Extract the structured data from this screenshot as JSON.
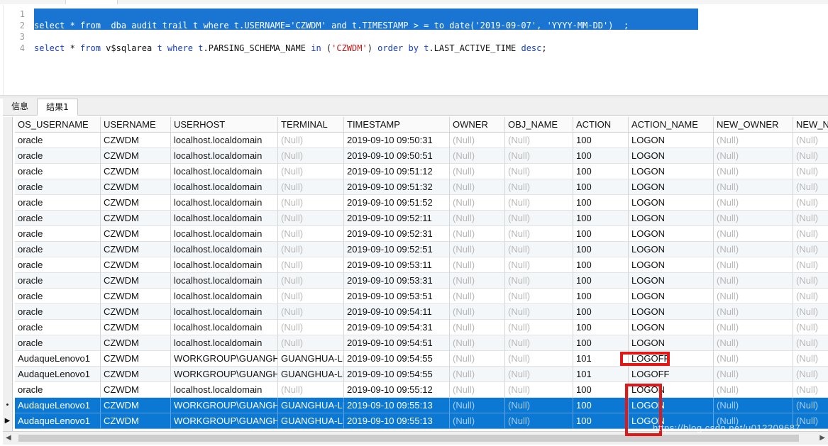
{
  "editor": {
    "line_numbers": [
      "1",
      "2",
      "3",
      "4"
    ],
    "line2": [
      {
        "t": "select",
        "c": "kw"
      },
      {
        "t": " * ",
        "c": "plain"
      },
      {
        "t": "from",
        "c": "kw"
      },
      {
        "t": "  dba_audit_trail t ",
        "c": "plain"
      },
      {
        "t": "where",
        "c": "kw"
      },
      {
        "t": " t.USERNAME=",
        "c": "plain"
      },
      {
        "t": "'CZWDM'",
        "c": "str"
      },
      {
        "t": " ",
        "c": "plain"
      },
      {
        "t": "and",
        "c": "kw"
      },
      {
        "t": " t.TIMESTAMP > = ",
        "c": "plain"
      },
      {
        "t": "to_date(",
        "c": "kw"
      },
      {
        "t": "'2019-09-07'",
        "c": "str"
      },
      {
        "t": ", ",
        "c": "plain"
      },
      {
        "t": "'YYYY-MM-DD'",
        "c": "str"
      },
      {
        "t": ")  ;",
        "c": "plain"
      }
    ],
    "line4": [
      {
        "t": "select",
        "c": "kw"
      },
      {
        "t": " * ",
        "c": "plain"
      },
      {
        "t": "from",
        "c": "kw"
      },
      {
        "t": " v$sqlarea ",
        "c": "plain"
      },
      {
        "t": "t",
        "c": "kw"
      },
      {
        "t": " ",
        "c": "plain"
      },
      {
        "t": "where",
        "c": "kw"
      },
      {
        "t": " ",
        "c": "plain"
      },
      {
        "t": "t",
        "c": "kw"
      },
      {
        "t": ".PARSING_SCHEMA_NAME ",
        "c": "plain"
      },
      {
        "t": "in",
        "c": "kw"
      },
      {
        "t": " (",
        "c": "plain"
      },
      {
        "t": "'CZWDM'",
        "c": "str"
      },
      {
        "t": ") ",
        "c": "plain"
      },
      {
        "t": "order by",
        "c": "kw"
      },
      {
        "t": " ",
        "c": "plain"
      },
      {
        "t": "t",
        "c": "kw"
      },
      {
        "t": ".LAST_ACTIVE_TIME ",
        "c": "plain"
      },
      {
        "t": "desc",
        "c": "kw"
      },
      {
        "t": ";",
        "c": "plain"
      }
    ]
  },
  "tabs": {
    "info_label": "信息",
    "result_label": "结果1"
  },
  "table": {
    "columns": [
      "OS_USERNAME",
      "USERNAME",
      "USERHOST",
      "TERMINAL",
      "TIMESTAMP",
      "OWNER",
      "OBJ_NAME",
      "ACTION",
      "ACTION_NAME",
      "NEW_OWNER",
      "NEW_NAME"
    ],
    "rows": [
      [
        "oracle",
        "CZWDM",
        "localhost.localdomain",
        "(Null)",
        "2019-09-10 09:50:31",
        "(Null)",
        "(Null)",
        "100",
        "LOGON",
        "(Null)",
        "(Null)"
      ],
      [
        "oracle",
        "CZWDM",
        "localhost.localdomain",
        "(Null)",
        "2019-09-10 09:50:51",
        "(Null)",
        "(Null)",
        "100",
        "LOGON",
        "(Null)",
        "(Null)"
      ],
      [
        "oracle",
        "CZWDM",
        "localhost.localdomain",
        "(Null)",
        "2019-09-10 09:51:12",
        "(Null)",
        "(Null)",
        "100",
        "LOGON",
        "(Null)",
        "(Null)"
      ],
      [
        "oracle",
        "CZWDM",
        "localhost.localdomain",
        "(Null)",
        "2019-09-10 09:51:32",
        "(Null)",
        "(Null)",
        "100",
        "LOGON",
        "(Null)",
        "(Null)"
      ],
      [
        "oracle",
        "CZWDM",
        "localhost.localdomain",
        "(Null)",
        "2019-09-10 09:51:52",
        "(Null)",
        "(Null)",
        "100",
        "LOGON",
        "(Null)",
        "(Null)"
      ],
      [
        "oracle",
        "CZWDM",
        "localhost.localdomain",
        "(Null)",
        "2019-09-10 09:52:11",
        "(Null)",
        "(Null)",
        "100",
        "LOGON",
        "(Null)",
        "(Null)"
      ],
      [
        "oracle",
        "CZWDM",
        "localhost.localdomain",
        "(Null)",
        "2019-09-10 09:52:31",
        "(Null)",
        "(Null)",
        "100",
        "LOGON",
        "(Null)",
        "(Null)"
      ],
      [
        "oracle",
        "CZWDM",
        "localhost.localdomain",
        "(Null)",
        "2019-09-10 09:52:51",
        "(Null)",
        "(Null)",
        "100",
        "LOGON",
        "(Null)",
        "(Null)"
      ],
      [
        "oracle",
        "CZWDM",
        "localhost.localdomain",
        "(Null)",
        "2019-09-10 09:53:11",
        "(Null)",
        "(Null)",
        "100",
        "LOGON",
        "(Null)",
        "(Null)"
      ],
      [
        "oracle",
        "CZWDM",
        "localhost.localdomain",
        "(Null)",
        "2019-09-10 09:53:31",
        "(Null)",
        "(Null)",
        "100",
        "LOGON",
        "(Null)",
        "(Null)"
      ],
      [
        "oracle",
        "CZWDM",
        "localhost.localdomain",
        "(Null)",
        "2019-09-10 09:53:51",
        "(Null)",
        "(Null)",
        "100",
        "LOGON",
        "(Null)",
        "(Null)"
      ],
      [
        "oracle",
        "CZWDM",
        "localhost.localdomain",
        "(Null)",
        "2019-09-10 09:54:11",
        "(Null)",
        "(Null)",
        "100",
        "LOGON",
        "(Null)",
        "(Null)"
      ],
      [
        "oracle",
        "CZWDM",
        "localhost.localdomain",
        "(Null)",
        "2019-09-10 09:54:31",
        "(Null)",
        "(Null)",
        "100",
        "LOGON",
        "(Null)",
        "(Null)"
      ],
      [
        "oracle",
        "CZWDM",
        "localhost.localdomain",
        "(Null)",
        "2019-09-10 09:54:51",
        "(Null)",
        "(Null)",
        "100",
        "LOGON",
        "(Null)",
        "(Null)"
      ],
      [
        "AudaqueLenovo1",
        "CZWDM",
        "WORKGROUP\\GUANGHUA",
        "GUANGHUA-LI",
        "2019-09-10 09:54:55",
        "(Null)",
        "(Null)",
        "101",
        "LOGOFF",
        "(Null)",
        "(Null)"
      ],
      [
        "AudaqueLenovo1",
        "CZWDM",
        "WORKGROUP\\GUANGHUA",
        "GUANGHUA-LI",
        "2019-09-10 09:54:55",
        "(Null)",
        "(Null)",
        "101",
        "LOGOFF",
        "(Null)",
        "(Null)"
      ],
      [
        "oracle",
        "CZWDM",
        "localhost.localdomain",
        "(Null)",
        "2019-09-10 09:55:12",
        "(Null)",
        "(Null)",
        "100",
        "LOGON",
        "(Null)",
        "(Null)"
      ],
      [
        "AudaqueLenovo1",
        "CZWDM",
        "WORKGROUP\\GUANGHUA",
        "GUANGHUA-LI",
        "2019-09-10 09:55:13",
        "(Null)",
        "(Null)",
        "100",
        "LOGON",
        "(Null)",
        "(Null)"
      ],
      [
        "AudaqueLenovo1",
        "CZWDM",
        "WORKGROUP\\GUANGHUA",
        "GUANGHUA-LI",
        "2019-09-10 09:55:13",
        "(Null)",
        "(Null)",
        "100",
        "LOGON",
        "(Null)",
        "(Null)"
      ]
    ],
    "selected_rows": [
      17,
      18
    ],
    "row_markers": {
      "17": "•",
      "18": "▶"
    }
  },
  "watermark": "https://blog.csdn.net/u012209687",
  "colors": {
    "selection": "#0b78d4",
    "keyword": "#1640c8",
    "string": "#c01818",
    "annotation": "#e21818"
  },
  "icons": {
    "scroll_left": "chevron-left-icon",
    "scroll_right": "chevron-right-icon"
  }
}
